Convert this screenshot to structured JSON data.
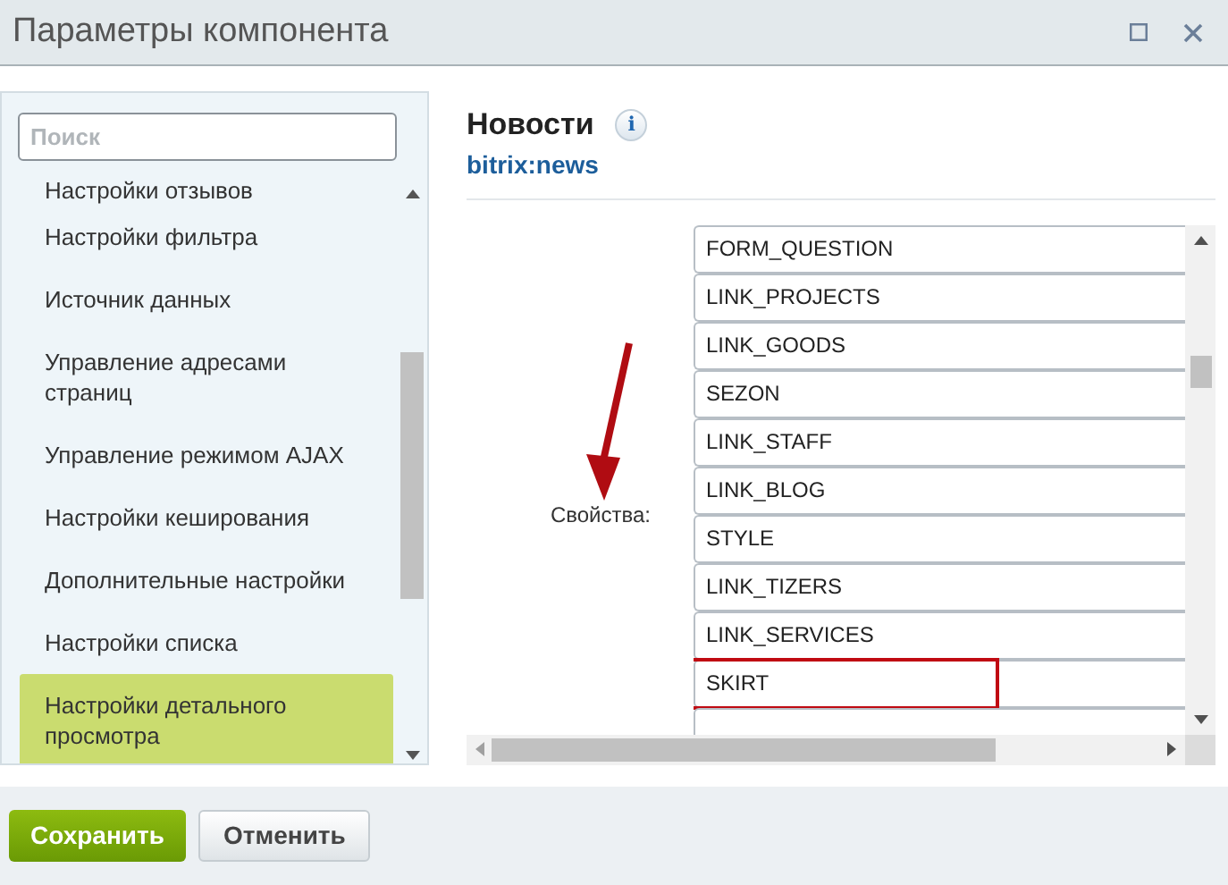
{
  "window": {
    "title": "Параметры компонента"
  },
  "sidebar": {
    "search": {
      "placeholder": "Поиск"
    },
    "items": [
      {
        "label": "Настройки отзывов",
        "selected": false
      },
      {
        "label": "Настройки фильтра",
        "selected": false
      },
      {
        "label": "Источник данных",
        "selected": false
      },
      {
        "label": "Управление адресами страниц",
        "selected": false
      },
      {
        "label": "Управление режимом AJAX",
        "selected": false
      },
      {
        "label": "Настройки кеширования",
        "selected": false
      },
      {
        "label": "Дополнительные настройки",
        "selected": false
      },
      {
        "label": "Настройки списка",
        "selected": false
      },
      {
        "label": "Настройки детального просмотра",
        "selected": true
      }
    ]
  },
  "component": {
    "title": "Новости",
    "info": "i",
    "code": "bitrix:news"
  },
  "property": {
    "label": "Свойства:",
    "options": [
      {
        "label": "FORM_QUESTION",
        "marked": false
      },
      {
        "label": "LINK_PROJECTS",
        "marked": false
      },
      {
        "label": "LINK_GOODS",
        "marked": false
      },
      {
        "label": "SEZON",
        "marked": false
      },
      {
        "label": "LINK_STAFF",
        "marked": false
      },
      {
        "label": "LINK_BLOG",
        "marked": false
      },
      {
        "label": "STYLE",
        "marked": false
      },
      {
        "label": "LINK_TIZERS",
        "marked": false
      },
      {
        "label": "LINK_SERVICES",
        "marked": false
      },
      {
        "label": "SKIRT",
        "marked": true
      },
      {
        "marked": false
      }
    ]
  },
  "buttons": [
    {
      "label": "Сохранить",
      "kind": "primary"
    },
    {
      "label": "Отменить",
      "kind": "secondary"
    }
  ]
}
